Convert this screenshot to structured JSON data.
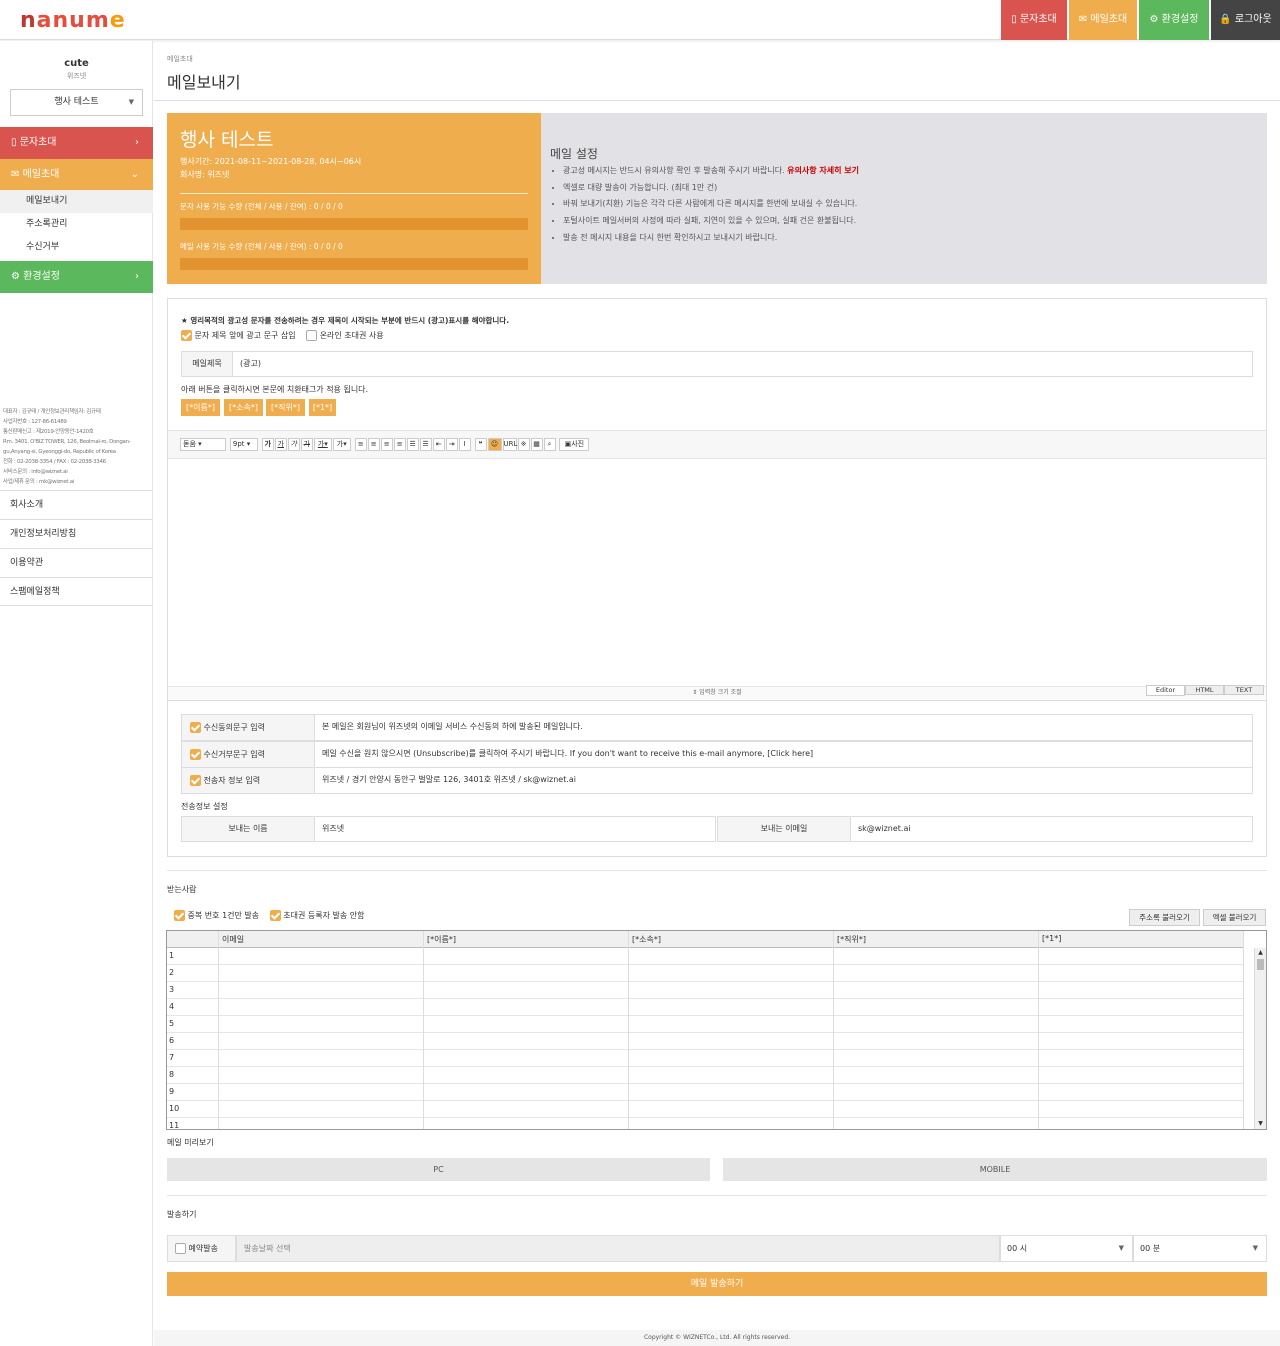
{
  "header": {
    "logo_text": "nanume",
    "buttons": [
      {
        "icon": "mobile-icon",
        "label": "문자초대",
        "color": "#d9534f"
      },
      {
        "icon": "envelope-icon",
        "label": "메일초대",
        "color": "#f0ad4e"
      },
      {
        "icon": "gear-icon",
        "label": "환경설정",
        "color": "#5cb85c"
      },
      {
        "icon": "lock-icon",
        "label": "로그아웃",
        "color": "#444444"
      }
    ]
  },
  "sidebar": {
    "user_name": "cute",
    "user_company": "위즈넷",
    "event_select": "행사 테스트",
    "menu": {
      "sms": "문자초대",
      "mail": "메일초대",
      "mail_sub": [
        "메일보내기",
        "주소록관리",
        "수신거부"
      ],
      "settings": "환경설정"
    },
    "company_info": [
      "대표자 : 김규태 / 개인정보관리책임자: 김규태",
      "사업자번호 : 127-86-61489",
      "통신판매신고 : 제2019-안양동안-1420호",
      "Rm. 3401, O'BIZ TOWER, 126, Beolmal-ro, Dongan-gu,Anyang-si, Gyeonggi-do, Republic of Korea",
      "전화 : 02-2038-3354  /  FAX : 02-2038-3346",
      "서비스문의 : info@wiznet.ai",
      "사업/제휴 문의 : mk@wiznet.ai"
    ],
    "footer_links": [
      "회사소개",
      "개인정보처리방침",
      "이용약관",
      "스팸메일정책"
    ]
  },
  "page": {
    "breadcrumb": "메일초대",
    "title": "메일보내기"
  },
  "event_panel": {
    "title": "행사 테스트",
    "period": "행사기간: 2021-08-11~2021-08-28, 04시~06시",
    "company": "회사명: 위즈넷",
    "sms_quota_label": "문자 사용 가능 수량",
    "sms_quota_detail": "(전체 / 사용 / 잔여) : 0 / 0 / 0",
    "mail_quota_label": "메일 사용 가능 수량",
    "mail_quota_detail": "(전체 / 사용 / 잔여) : 0 / 0 / 0",
    "sms_progress": 0,
    "mail_progress": 0
  },
  "mail_settings": {
    "title": "메일 설정",
    "notes": [
      "광고성 메시지는 반드시 유의사항 확인 후 발송해 주시기 바랍니다.",
      "엑셀로 대량 발송이 가능합니다. (최대 1만 건)",
      "바꿔 보내기(치환) 기능은 각각 다른 사람에게 다른 메시지를 한번에 보내실 수 있습니다.",
      "포털사이트 메일서버의 사정에 따라 실패, 지연이 있을 수 있으며, 실패 건은 환불됩니다.",
      "발송 전 메시지 내용을 다시 한번 확인하시고 보내시기 바랍니다."
    ],
    "notice_link": "유의사항 자세히 보기"
  },
  "compose": {
    "ad_notice": "★ 영리목적의 광고성 문자를 전송하려는 경우 제목이 시작되는 부분에 반드시 (광고)표시를 해야합니다.",
    "insert_ad_label": "문자 제목 앞에 광고 문구 삽입",
    "online_invite_label": "온라인 초대권 사용",
    "subject_label": "메일제목",
    "subject_value": "(광고)",
    "tag_hint": "아래 버튼을 클릭하시면 본문에 치환태그가 적용 됩니다.",
    "tags": [
      "[*이름*]",
      "[*소속*]",
      "[*직위*]",
      "[*1*]"
    ],
    "editor_toolbar": {
      "font": "돋움",
      "size": "9pt",
      "photo": "사진"
    },
    "resize_label": "입력창 크기 조절",
    "editor_tabs": [
      "Editor",
      "HTML",
      "TEXT"
    ]
  },
  "footer_fields": [
    {
      "label": "수신동의문구 입력",
      "value": "본 메일은 회원님이 위즈넷의 이메일 서비스 수신동의 하에 발송된 메일입니다."
    },
    {
      "label": "수신거부문구 입력",
      "value": "메일 수신을 원치 않으시면 (Unsubscribe)를 클릭하여 주시기 바랍니다. If you don't want to receive this e-mail anymore, [Click here]"
    },
    {
      "label": "전송자 정보 입력",
      "value": "위즈넷 / 경기 안양시 동안구 벌말로 126, 3401호 위즈넷 / sk@wiznet.ai"
    }
  ],
  "sender": {
    "section_label": "전송정보 설정",
    "name_label": "보내는 이름",
    "name_value": "위즈넷",
    "email_label": "보내는 이메일",
    "email_value": "sk@wiznet.ai"
  },
  "recipients": {
    "title": "받는사람",
    "dup_label": "중복 번호 1건만 발송",
    "exclude_label": "초대권 등록자 발송 안함",
    "address_btn": "주소록 불러오기",
    "excel_btn": "엑셀 불러오기",
    "columns": [
      "이메일",
      "[*이름*]",
      "[*소속*]",
      "[*직위*]",
      "[*1*]"
    ],
    "rows": [
      "1",
      "2",
      "3",
      "4",
      "5",
      "6",
      "7",
      "8",
      "9",
      "10",
      "11"
    ]
  },
  "preview": {
    "title": "메일 미리보기",
    "pc": "PC",
    "mobile": "MOBILE"
  },
  "send": {
    "title": "발송하기",
    "reserve_label": "예약발송",
    "date_placeholder": "발송날짜 선택",
    "hour": "00 시",
    "minute": "00 분",
    "submit": "메일 발송하기"
  },
  "copyright": "Copyright © WIZNETCo., Ltd. All rights reserved."
}
